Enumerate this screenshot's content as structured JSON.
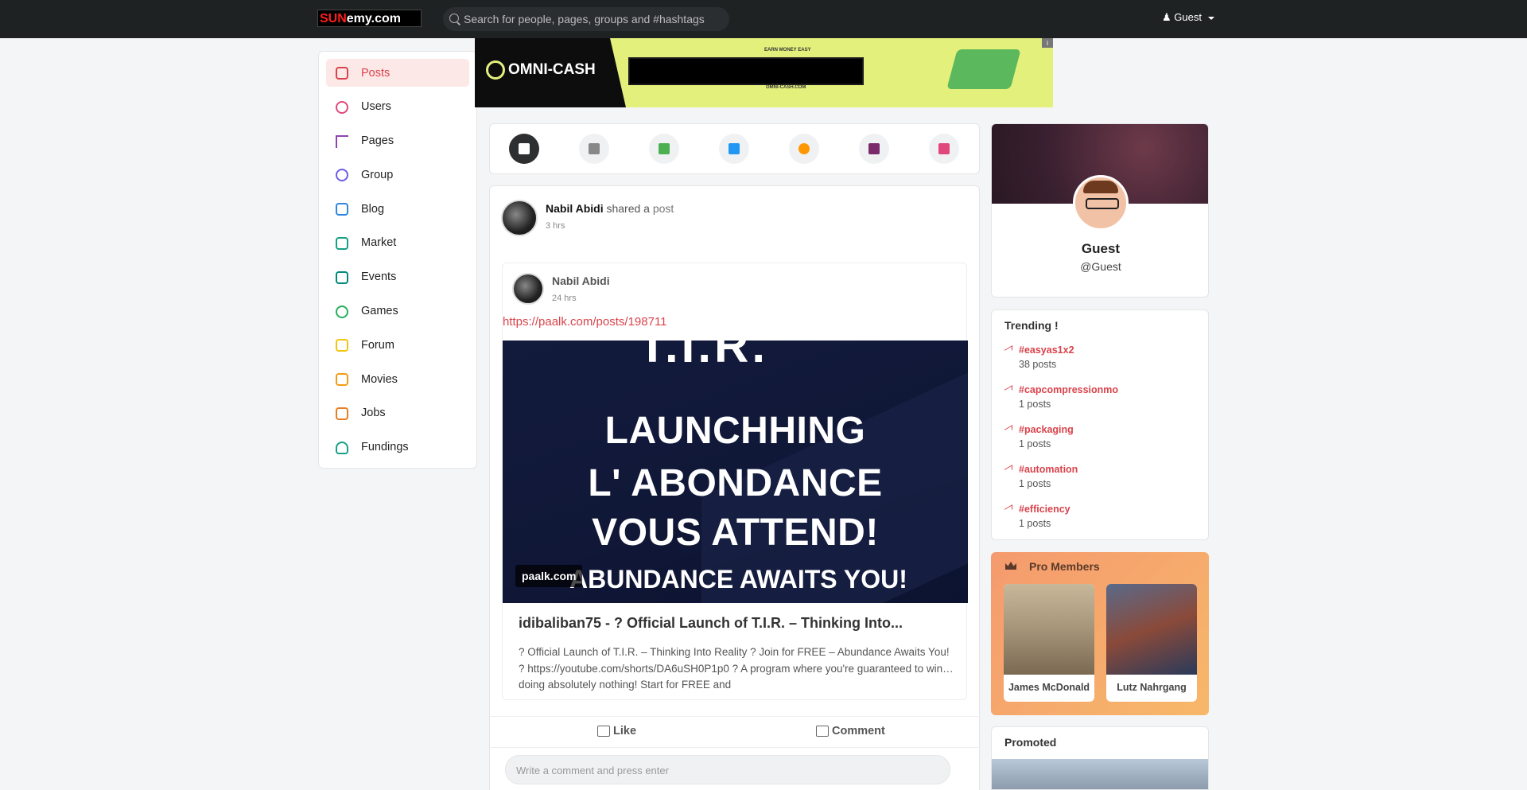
{
  "topbar": {
    "logo_prefix": "SUN",
    "logo_suffix": "emy.com",
    "search_placeholder": "Search for people, pages, groups and #hashtags",
    "user_label": "Guest"
  },
  "sidebar": {
    "items": [
      {
        "label": "Posts",
        "color": "#d9434b"
      },
      {
        "label": "Users",
        "color": "#e0477a"
      },
      {
        "label": "Pages",
        "color": "#8e44ad"
      },
      {
        "label": "Group",
        "color": "#6c5ce7"
      },
      {
        "label": "Blog",
        "color": "#2e86de"
      },
      {
        "label": "Market",
        "color": "#16a085"
      },
      {
        "label": "Events",
        "color": "#00897b"
      },
      {
        "label": "Games",
        "color": "#27ae60"
      },
      {
        "label": "Forum",
        "color": "#f1c40f"
      },
      {
        "label": "Movies",
        "color": "#f39c12"
      },
      {
        "label": "Jobs",
        "color": "#e67e22"
      },
      {
        "label": "Fundings",
        "color": "#16a085"
      }
    ]
  },
  "ad": {
    "brand": "OMNI-CASH",
    "tagline": "EARN MONEY EASY",
    "url": "OMNI-CASH.COM",
    "badge": "i"
  },
  "composer": {
    "buttons": [
      {
        "name": "text-post-icon",
        "color": "#ffffff"
      },
      {
        "name": "status-icon",
        "color": "#888888"
      },
      {
        "name": "photo-icon",
        "color": "#4caf50"
      },
      {
        "name": "video-icon",
        "color": "#2196f3"
      },
      {
        "name": "music-icon",
        "color": "#ff9800"
      },
      {
        "name": "file-icon",
        "color": "#7b2a6b"
      },
      {
        "name": "map-icon",
        "color": "#e0477a"
      }
    ]
  },
  "post": {
    "author": "Nabil Abidi",
    "shared_text": "shared a",
    "shared_link": "post",
    "time": "3 hrs",
    "shared": {
      "author": "Nabil Abidi",
      "time": "24 hrs",
      "link": "https://paalk.com/posts/198711",
      "banner_top": "T.I.R.",
      "banner_lines": [
        "LAUNCHHING",
        "L' ABONDANCE",
        "VOUS ATTEND!"
      ],
      "banner_sub": "ABUNDANCE AWAITS YOU!",
      "banner_tag": "paalk.com",
      "title": "idibaliban75 - ? Official Launch of T.I.R. – Thinking Into...",
      "description": "? Official Launch of T.I.R. – Thinking Into Reality ? Join for FREE – Abundance Awaits You! ? https://youtube.com/shorts/DA6uSH0P1p0 ? A program where you're guaranteed to win… doing absolutely nothing! Start for FREE and"
    },
    "like_label": "Like",
    "comment_label": "Comment",
    "comment_placeholder": "Write a comment and press enter"
  },
  "profile": {
    "name": "Guest",
    "handle": "@Guest"
  },
  "trending": {
    "title": "Trending !",
    "items": [
      {
        "tag": "#easyas1x2",
        "count": "38 posts"
      },
      {
        "tag": "#capcompressionmo",
        "count": "1 posts"
      },
      {
        "tag": "#packaging",
        "count": "1 posts"
      },
      {
        "tag": "#automation",
        "count": "1 posts"
      },
      {
        "tag": "#efficiency",
        "count": "1 posts"
      }
    ]
  },
  "pro_members": {
    "title": "Pro Members",
    "members": [
      {
        "name": "James McDonald"
      },
      {
        "name": "Lutz Nahrgang"
      }
    ]
  },
  "promoted": {
    "title": "Promoted"
  }
}
